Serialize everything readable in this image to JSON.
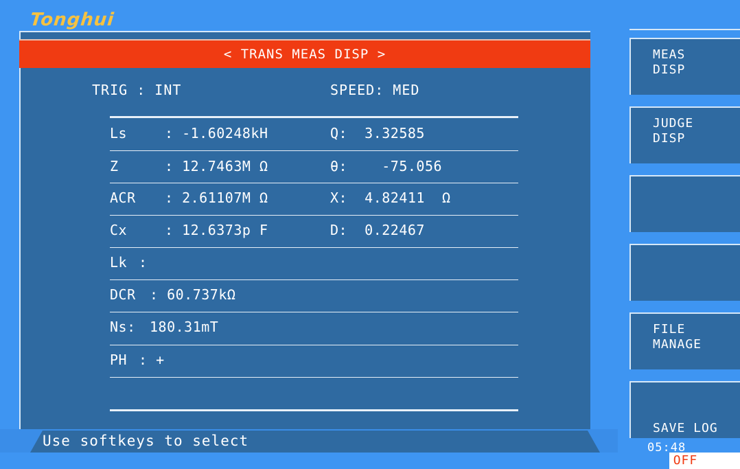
{
  "brand": {
    "logo": "Tonghui"
  },
  "screen": {
    "title": "< TRANS MEAS DISP >",
    "trigger": "TRIG : INT",
    "speed": "SPEED: MED"
  },
  "measurements": [
    {
      "label": "Ls",
      "value": ":  -1.60248kH",
      "right": "Q:  3.32585"
    },
    {
      "label": "Z",
      "value": ":  12.7463M Ω",
      "right": "θ:    -75.056"
    },
    {
      "label": "ACR",
      "value": ":  2.61107M Ω",
      "right": "X:  4.82411  Ω"
    },
    {
      "label": "Cx",
      "value": ":  12.6373p F",
      "right": "D:  0.22467"
    },
    {
      "label": "Lk",
      "value": ":",
      "right": ""
    },
    {
      "label": "DCR",
      "value": ": 60.737kΩ",
      "right": ""
    },
    {
      "label": "Ns:",
      "value": "  180.31mT",
      "right": ""
    },
    {
      "label": "PH",
      "value": ":  +",
      "right": ""
    }
  ],
  "status": {
    "message": "Use softkeys to select",
    "time": "05:48"
  },
  "softkeys": [
    {
      "label": "MEAS\nDISP"
    },
    {
      "label": "JUDGE\nDISP"
    },
    {
      "label": ""
    },
    {
      "label": ""
    },
    {
      "label": "FILE\nMANAGE"
    },
    {
      "label": "SAVE LOG",
      "value": "OFF"
    }
  ],
  "colors": {
    "background": "#3e95f2",
    "panel": "#2f6aa1",
    "title_bar": "#f03b12",
    "logo": "#f5c242"
  }
}
